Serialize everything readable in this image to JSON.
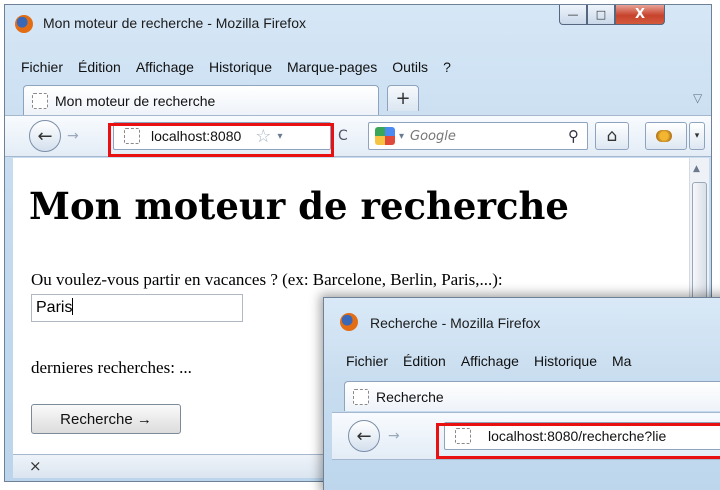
{
  "window_main": {
    "title": "Mon moteur de recherche - Mozilla Firefox",
    "menu": [
      "Fichier",
      "Édition",
      "Affichage",
      "Historique",
      "Marque-pages",
      "Outils",
      "?"
    ],
    "controls": {
      "minimize": "—",
      "maximize": "□",
      "close": "X"
    },
    "tab": {
      "label": "Mon moteur de recherche"
    },
    "new_tab": "+",
    "tab_list": "▽",
    "nav": {
      "back": "←",
      "forward": "→",
      "url": "localhost:8080",
      "star": "☆",
      "url_dropdown": "▾",
      "reload": "C",
      "search_placeholder": "Google",
      "search_engine_dropdown": "▾",
      "search_go": "⚲",
      "home": "⌂",
      "addon_menu": "▾"
    },
    "page": {
      "heading": "Mon moteur de recherche",
      "prompt": "Ou voulez-vous partir en vacances ? (ex: Barcelone, Berlin, Paris,...):",
      "input_value": "Paris",
      "recent": "dernieres recherches: ...",
      "button": "Recherche →"
    },
    "findbar_close": "×",
    "scroll_up": "▲"
  },
  "window_second": {
    "title": "Recherche - Mozilla Firefox",
    "menu": [
      "Fichier",
      "Édition",
      "Affichage",
      "Historique",
      "Ma"
    ],
    "tab": {
      "label": "Recherche"
    },
    "nav": {
      "back": "←",
      "forward": "→",
      "url": "localhost:8080/recherche?lie"
    }
  },
  "colors": {
    "highlight": "#e81010",
    "frame": "#c5dbef"
  }
}
